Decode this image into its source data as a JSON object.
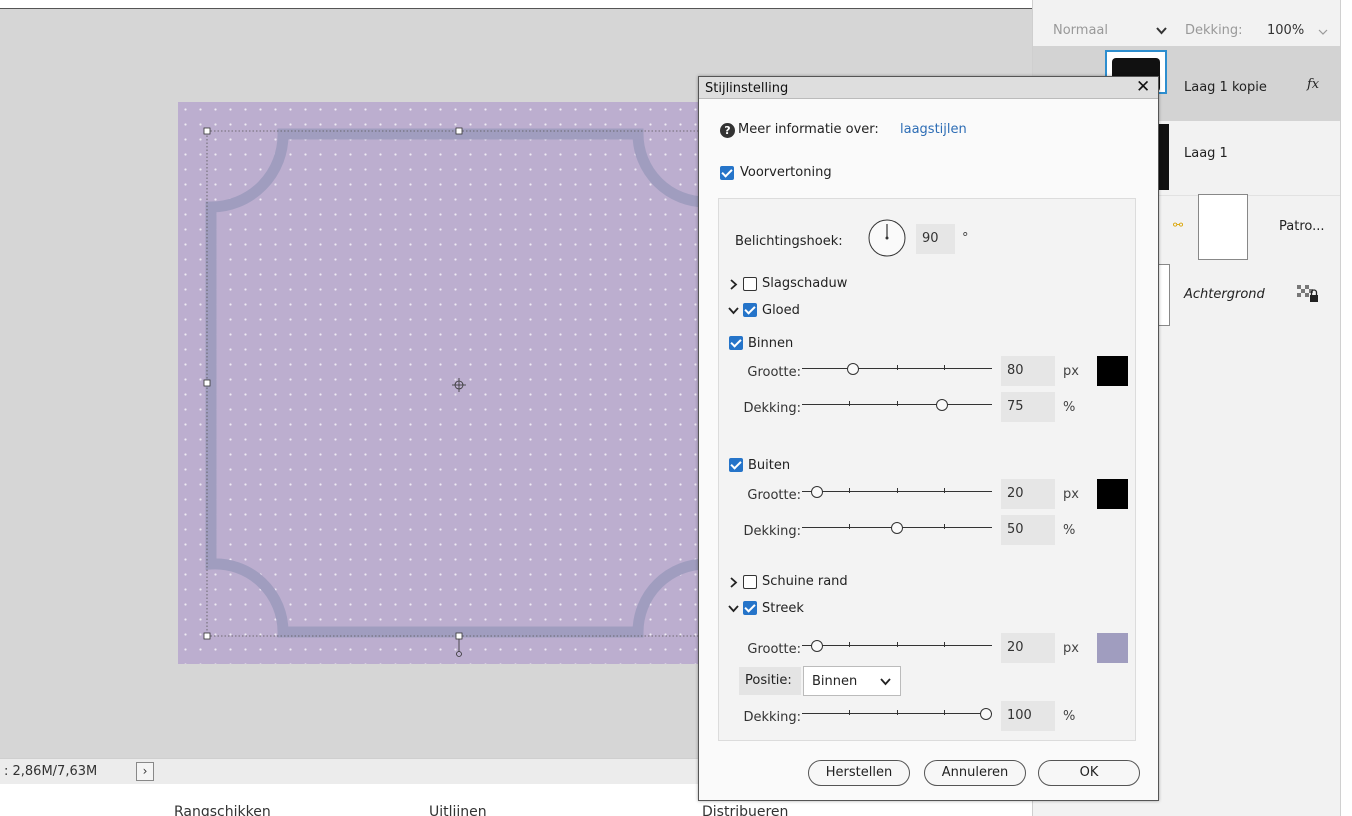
{
  "status": {
    "doc_info": ": 2,86M/7,63M",
    "expand_arrow": "›"
  },
  "bottom_bar": {
    "arrange": "Rangschikken",
    "align": "Uitlijnen",
    "distribute": "Distribueren"
  },
  "layers_panel": {
    "blend_mode": "Normaal",
    "opacity_label": "Dekking:",
    "opacity_value": "100%",
    "layers": [
      {
        "name": "Laag 1 kopie",
        "fx": "fx",
        "selected": true
      },
      {
        "name": "Laag 1"
      },
      {
        "name": "Patro..."
      },
      {
        "name": "Achtergrond",
        "italic": true
      }
    ]
  },
  "dialog": {
    "title": "Stijlinstelling",
    "close_glyph": "✕",
    "info_text": "Meer informatie over:",
    "info_link": "laagstijlen",
    "preview_label": "Voorvertoning",
    "preview_checked": true,
    "light_angle_label": "Belichtingshoek:",
    "light_angle_value": "90",
    "light_angle_unit": "°",
    "sections": {
      "drop_shadow": {
        "label": "Slagschaduw",
        "checked": false,
        "expanded": false
      },
      "glow": {
        "label": "Gloed",
        "checked": true,
        "expanded": true
      },
      "bevel": {
        "label": "Schuine rand",
        "checked": false,
        "expanded": false
      },
      "stroke": {
        "label": "Streek",
        "checked": true,
        "expanded": true
      }
    },
    "inner_glow": {
      "label": "Binnen",
      "checked": true,
      "size_label": "Grootte:",
      "size_value": "80",
      "size_unit": "px",
      "size_fraction": 0.25,
      "opacity_label": "Dekking:",
      "opacity_value": "75",
      "opacity_unit": "%",
      "opacity_fraction": 0.75,
      "color": "#000000"
    },
    "outer_glow": {
      "label": "Buiten",
      "checked": true,
      "size_label": "Grootte:",
      "size_value": "20",
      "size_unit": "px",
      "size_fraction": 0.05,
      "opacity_label": "Dekking:",
      "opacity_value": "50",
      "opacity_unit": "%",
      "opacity_fraction": 0.5,
      "color": "#000000"
    },
    "stroke": {
      "size_label": "Grootte:",
      "size_value": "20",
      "size_unit": "px",
      "size_fraction": 0.05,
      "position_label": "Positie:",
      "position_value": "Binnen",
      "opacity_label": "Dekking:",
      "opacity_value": "100",
      "opacity_unit": "%",
      "opacity_fraction": 1.0,
      "color": "#a09dbf"
    },
    "buttons": {
      "reset": "Herstellen",
      "cancel": "Annuleren",
      "ok": "OK"
    }
  },
  "colors": {
    "canvas": "#bcaecf",
    "frame_stroke": "#a09dbf",
    "accent": "#2574c9"
  }
}
